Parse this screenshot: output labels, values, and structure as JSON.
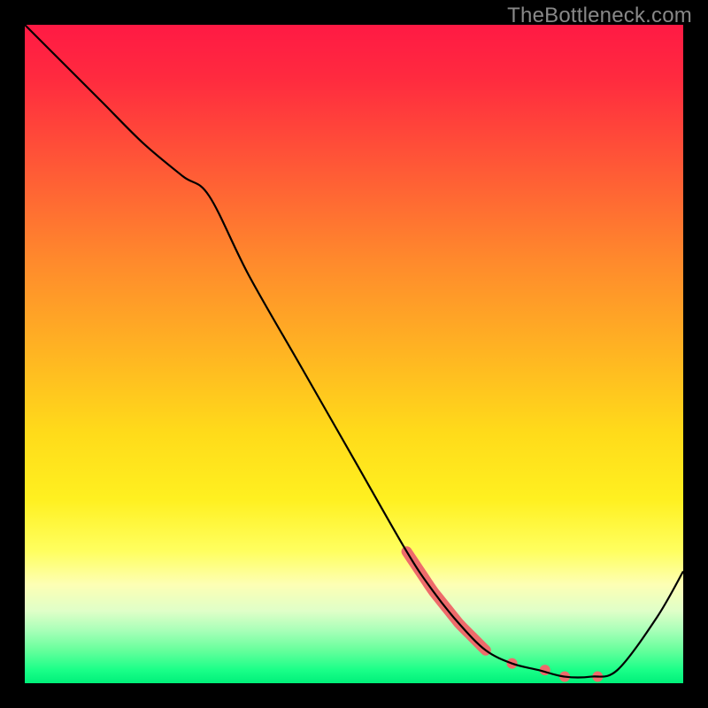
{
  "watermark": "TheBottleneck.com",
  "chart_data": {
    "type": "line",
    "title": "",
    "xlabel": "",
    "ylabel": "",
    "xlim": [
      0,
      100
    ],
    "ylim": [
      0,
      100
    ],
    "series": [
      {
        "name": "curve",
        "color": "#000000",
        "x": [
          0,
          6,
          12,
          18,
          24,
          28,
          34,
          42,
          50,
          58,
          62,
          66,
          70,
          74,
          78,
          82,
          86,
          90,
          96,
          100
        ],
        "values": [
          100,
          94,
          88,
          82,
          77,
          74,
          62,
          48,
          34,
          20,
          14,
          9,
          5,
          3,
          2,
          1,
          1,
          2,
          10,
          17
        ]
      }
    ],
    "highlights": [
      {
        "type": "thick_segment",
        "color": "#ee6b6b",
        "from_x": 58,
        "to_x": 70
      },
      {
        "type": "dot",
        "color": "#ee6b6b",
        "x": 74,
        "y": 3
      },
      {
        "type": "dot",
        "color": "#ee6b6b",
        "x": 79,
        "y": 2
      },
      {
        "type": "dot",
        "color": "#ee6b6b",
        "x": 82,
        "y": 1
      },
      {
        "type": "dot",
        "color": "#ee6b6b",
        "x": 87,
        "y": 1
      }
    ]
  }
}
